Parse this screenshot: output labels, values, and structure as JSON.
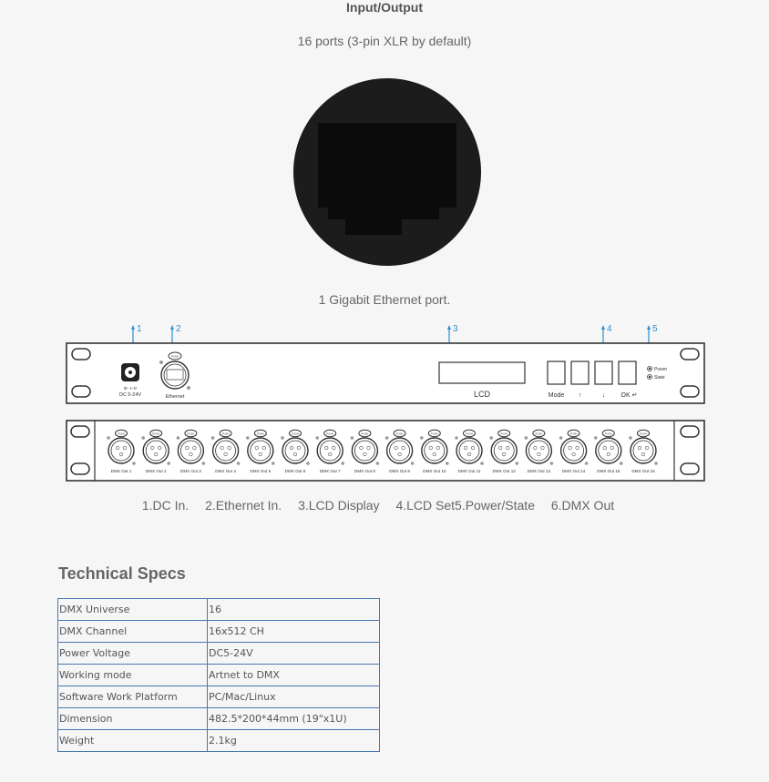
{
  "io_section": {
    "title": "Input/Output",
    "subtitle": "16 ports (3-pin XLR by default)",
    "ethernet_caption": "1 Gigabit Ethernet port."
  },
  "panel": {
    "callouts": [
      "1",
      "2",
      "3",
      "4",
      "5"
    ],
    "front": {
      "dc_label": "DC 5-24V",
      "dc_polarity": "⊕-◑-⊖",
      "ethernet_label": "Ethernet",
      "push_label": "PUSH",
      "lcd_label": "LCD",
      "buttons": [
        "Mode",
        "↑",
        "↓",
        "OK ↵"
      ],
      "leds": [
        "Power",
        "State"
      ]
    },
    "rear": {
      "outputs": [
        "DMX Out 1",
        "DMX Out 2",
        "DMX Out 3",
        "DMX Out 4",
        "DMX Out 5",
        "DMX Out 6",
        "DMX Out 7",
        "DMX Out 8",
        "DMX Out 9",
        "DMX Out 10",
        "DMX Out 11",
        "DMX Out 12",
        "DMX Out 13",
        "DMX Out 14",
        "DMX Out 15",
        "DMX Out 16"
      ]
    },
    "accent_color": "#2a8fd0",
    "line_color": "#333333"
  },
  "legend": [
    "1.DC In.",
    "2.Ethernet In.",
    "3.LCD Display",
    "4.LCD Set5.Power/State",
    "6.DMX Out"
  ],
  "specs": {
    "title": "Technical Specs",
    "border_color": "#4a78b0",
    "rows": [
      {
        "key": "DMX Universe",
        "value": "16"
      },
      {
        "key": "DMX Channel",
        "value": "16x512 CH"
      },
      {
        "key": "Power Voltage",
        "value": "DC5-24V"
      },
      {
        "key": "Working mode",
        "value": "Artnet to DMX"
      },
      {
        "key": "Software Work Platform",
        "value": "PC/Mac/Linux"
      },
      {
        "key": "Dimension",
        "value": "482.5*200*44mm (19\"x1U)"
      },
      {
        "key": "Weight",
        "value": "2.1kg"
      }
    ]
  }
}
